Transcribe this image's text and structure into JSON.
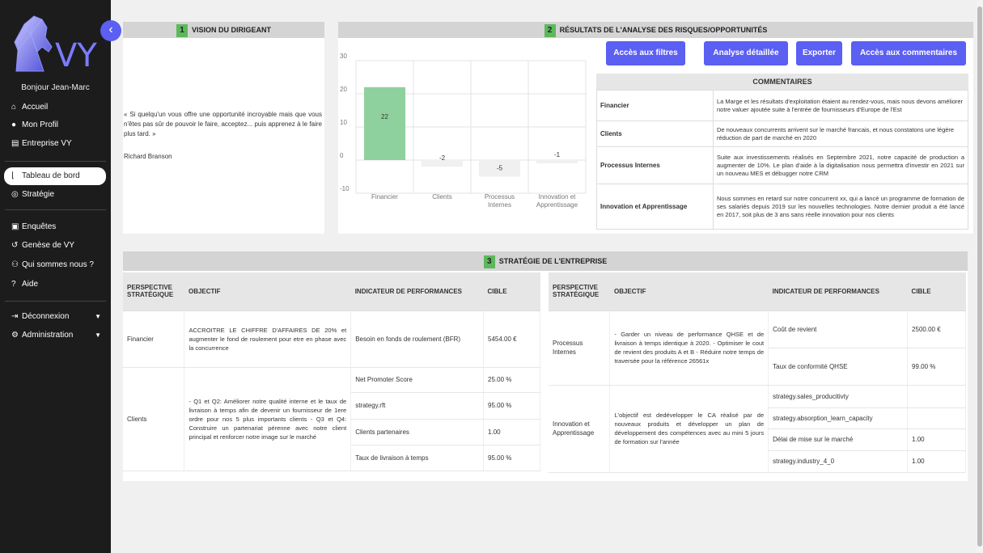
{
  "sidebar": {
    "logo_text": "VY",
    "greeting": "Bonjour Jean-Marc",
    "items": [
      {
        "icon": "home-icon",
        "glyph": "⌂",
        "label": "Accueil"
      },
      {
        "icon": "user-icon",
        "glyph": "●",
        "label": "Mon Profil"
      },
      {
        "icon": "building-icon",
        "glyph": "▤",
        "label": "Entreprise VY"
      },
      {
        "icon": "chart-line-icon",
        "glyph": "⌊",
        "label": "Tableau de bord"
      },
      {
        "icon": "target-icon",
        "glyph": "◎",
        "label": "Stratégie"
      },
      {
        "icon": "clipboard-icon",
        "glyph": "▣",
        "label": "Enquêtes"
      },
      {
        "icon": "history-icon",
        "glyph": "↺",
        "label": "Genèse de VY"
      },
      {
        "icon": "users-icon",
        "glyph": "⚇",
        "label": "Qui sommes nous ?"
      },
      {
        "icon": "question-icon",
        "glyph": "?",
        "label": "Aide"
      },
      {
        "icon": "logout-icon",
        "glyph": "⇥",
        "label": "Déconnexion"
      },
      {
        "icon": "cogs-icon",
        "glyph": "⚙",
        "label": "Administration"
      }
    ],
    "accent": "#5b5ff2"
  },
  "vision": {
    "number": "1",
    "title": "VISION DU DIRIGEANT",
    "quote": "« Si quelqu'un vous offre une opportunité incroyable mais que vous n'êtes pas sûr de pouvoir le faire, acceptez... puis apprenez à le faire plus tard. »",
    "author": "Richard Branson"
  },
  "risks": {
    "number": "2",
    "title": "RÉSULTATS DE L'ANALYSE DES RISQUES/OPPORTUNITÉS",
    "buttons": [
      "Accès aux filtres",
      "Analyse détaillée",
      "Exporter",
      "Accès aux commentaires"
    ],
    "comments_title": "COMMENTAIRES",
    "comments": [
      {
        "label": "Financier",
        "text": "La Marge et les résultats d'exploitation étaient au rendez-vous, mais nous devons améliorer notre valuer ajoutée suite à l'entrée de fournisseurs d'Europe de l'Est"
      },
      {
        "label": "Clients",
        "text": "De nouveaux concurrents arrivent sur le marché francais, et nous constatons une légère réduction de part de marché en 2020"
      },
      {
        "label": "Processus Internes",
        "text": "Suite aux investissements réalisés en Septembre 2021, notre capacité de production a augmenter de 10%. Le plan d'aide à la digitalisation nous permettra d'investir en 2021 sur un nouveau MES et débugger notre CRM"
      },
      {
        "label": "Innovation et Apprentissage",
        "text": "Nous sommes en retard sur notre concurrent xx, qui a lancé un programme de formation de ses salariés depuis 2019 sur les nouvelles technologies. Notre dernier produit a été lancé en 2017, soit plus de 3 ans sans réelle innovation pour nos clients"
      }
    ]
  },
  "chart_data": {
    "type": "bar",
    "categories": [
      "Financier",
      "Clients",
      "Processus Internes",
      "Innovation et Apprentissage"
    ],
    "values": [
      22,
      -2,
      -5,
      -1
    ],
    "ylim": [
      -10,
      30
    ],
    "yticks": [
      -10,
      0,
      10,
      20,
      30
    ],
    "colors": [
      "#8fd19e",
      "#f0f0f0",
      "#f0f0f0",
      "#f0f0f0"
    ],
    "grid": true
  },
  "strategy": {
    "number": "3",
    "title": "STRATÉGIE DE L'ENTREPRISE",
    "headers": [
      "PERSPECTIVE STRATÉGIQUE",
      "OBJECTIF",
      "INDICATEUR DE PERFORMANCES",
      "CIBLE"
    ],
    "left": {
      "fin_persp": "Financier",
      "fin_obj": "ACCROITRE LE CHIFFRE D'AFFAIRES DE 20% et augmenter le fond de roulement pour etre en phase avec la concurrence",
      "fin_rows": [
        [
          "Besoin en fonds de roulement (BFR)",
          "5454.00 €"
        ]
      ],
      "cli_persp": "Clients",
      "cli_obj": "- Q1 et Q2: Améliorer notre qualité interne et le taux de livraison à temps afin de devenir un fournisseur de 1ere ordre pour nos 5 plus importants clients - Q3 et Q4: Construire un partenariat pérenne avec notre client principal et renforcer notre image sur le marché",
      "cli_rows": [
        [
          "Net Promoter Score",
          "25.00 %"
        ],
        [
          "strategy.rft",
          "95.00 %"
        ],
        [
          "Clients partenaires",
          "1.00"
        ],
        [
          "Taux de livraison à temps",
          "95.00 %"
        ]
      ]
    },
    "right": {
      "pi_persp": "Processus Internes",
      "pi_obj": "- Garder un niveau de performance QHSE et de livraison à temps identique à 2020. - Optimiser le cout de revient des produits A et B - Réduire notre temps de traversée pour la référence 26561x",
      "pi_rows": [
        [
          "Coût de revient",
          "2500.00 €"
        ],
        [
          "Taux de conformité QHSE",
          "99.00 %"
        ]
      ],
      "ia_persp": "Innovation et Apprentissage",
      "ia_obj": "L'objectif est dedévelopper le CA réalisé par de nouveaux produits et développer un plan de développement des compétences avec au mini 5 jours de formation sur l'année",
      "ia_rows": [
        [
          "strategy.sales_producitivty",
          ""
        ],
        [
          "strategy.absorption_learn_capacity",
          ""
        ],
        [
          "Délai de mise sur le marché",
          "1.00"
        ],
        [
          "strategy.industry_4_0",
          "1.00"
        ]
      ]
    }
  }
}
